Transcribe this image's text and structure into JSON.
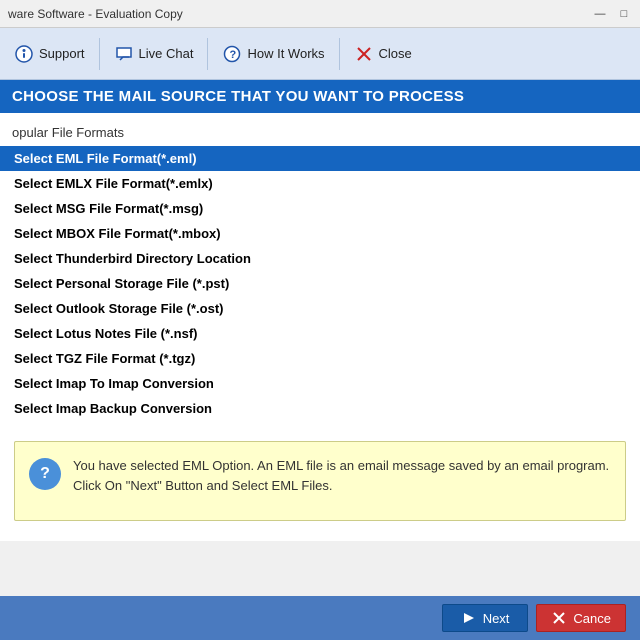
{
  "titleBar": {
    "title": "ware Software - Evaluation Copy",
    "minimizeIcon": "—",
    "maximizeIcon": "□"
  },
  "toolbar": {
    "buttons": [
      {
        "id": "support",
        "label": "Support",
        "icon": "support-icon"
      },
      {
        "id": "live-chat",
        "label": "Live Chat",
        "icon": "chat-icon"
      },
      {
        "id": "how-it-works",
        "label": "How It Works",
        "icon": "question-icon"
      },
      {
        "id": "close",
        "label": "Close",
        "icon": "close-icon"
      }
    ]
  },
  "headerBar": {
    "text": "CHOOSE THE MAIL SOURCE THAT YOU WANT TO PROCESS"
  },
  "sectionLabel": "opular File Formats",
  "formatList": [
    {
      "id": "eml",
      "label": "Select EML File Format(*.eml)",
      "selected": true
    },
    {
      "id": "emlx",
      "label": "Select EMLX File Format(*.emlx)",
      "selected": false
    },
    {
      "id": "msg",
      "label": "Select MSG File Format(*.msg)",
      "selected": false
    },
    {
      "id": "mbox",
      "label": "Select MBOX File Format(*.mbox)",
      "selected": false
    },
    {
      "id": "thunderbird",
      "label": "Select Thunderbird Directory Location",
      "selected": false
    },
    {
      "id": "pst",
      "label": "Select Personal Storage File (*.pst)",
      "selected": false
    },
    {
      "id": "ost",
      "label": "Select Outlook Storage File (*.ost)",
      "selected": false
    },
    {
      "id": "nsf",
      "label": "Select Lotus Notes File (*.nsf)",
      "selected": false
    },
    {
      "id": "tgz",
      "label": "Select TGZ File Format (*.tgz)",
      "selected": false
    },
    {
      "id": "imap-convert",
      "label": "Select Imap To Imap Conversion",
      "selected": false
    },
    {
      "id": "imap-backup",
      "label": "Select Imap Backup Conversion",
      "selected": false
    }
  ],
  "infoBox": {
    "text": "You have selected EML Option. An EML file is an email message saved by an email program. Click On \"Next\" Button and Select EML Files.",
    "icon": "?"
  },
  "bottomBar": {
    "nextLabel": "Next",
    "cancelLabel": "Cance"
  }
}
